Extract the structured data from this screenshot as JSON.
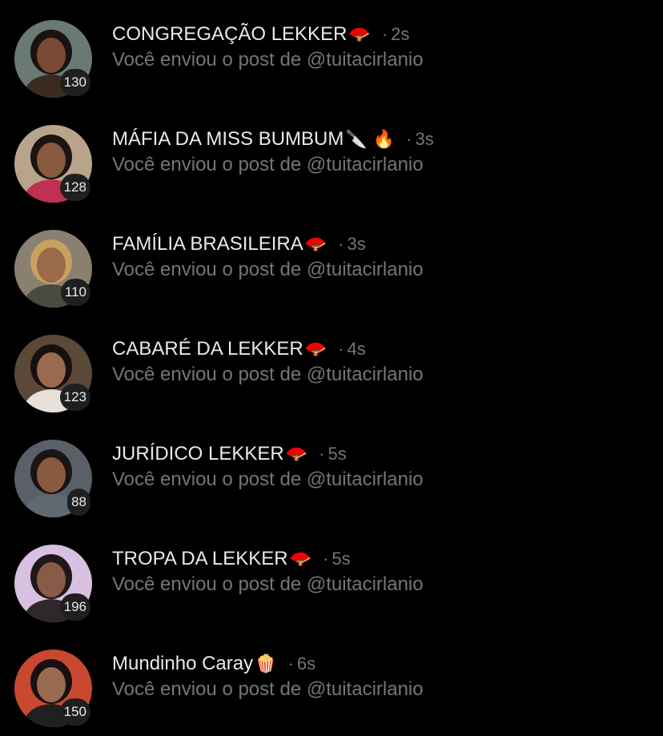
{
  "conversations": [
    {
      "name": "CONGREGAÇÃO LEKKER",
      "emoji": "🪭",
      "separator": "·",
      "time": "2s",
      "preview": "Você enviou o post de @tuitacirlanio",
      "member_count": "130",
      "avatar_colors": {
        "bg": "#6a7a72",
        "skin": "#7a4a35",
        "hair": "#1a1210",
        "cloth": "#3a2a20"
      }
    },
    {
      "name": "MÁFIA DA MISS BUMBUM",
      "emoji": "🔪 🔥",
      "separator": "·",
      "time": "3s",
      "preview": "Você enviou o post de @tuitacirlanio",
      "member_count": "128",
      "avatar_colors": {
        "bg": "#b8a48a",
        "skin": "#8a5a40",
        "hair": "#1c1410",
        "cloth": "#c03050"
      }
    },
    {
      "name": "FAMÍLIA BRASILEIRA",
      "emoji": "🪭",
      "separator": "·",
      "time": "3s",
      "preview": "Você enviou o post de @tuitacirlanio",
      "member_count": "110",
      "avatar_colors": {
        "bg": "#8a8070",
        "skin": "#9a6a4a",
        "hair": "#c8a060",
        "cloth": "#4a4a40"
      }
    },
    {
      "name": "CABARÉ DA LEKKER ",
      "emoji": "🪭",
      "separator": "·",
      "time": "4s",
      "preview": "Você enviou o post de @tuitacirlanio",
      "member_count": "123",
      "avatar_colors": {
        "bg": "#5a4838",
        "skin": "#9a6a50",
        "hair": "#181010",
        "cloth": "#e8e0d8"
      }
    },
    {
      "name": "JURÍDICO LEKKER",
      "emoji": "🪭",
      "separator": "·",
      "time": "5s",
      "preview": "Você enviou o post de @tuitacirlanio",
      "member_count": "88",
      "avatar_colors": {
        "bg": "#5a6068",
        "skin": "#8a5a40",
        "hair": "#1a1412",
        "cloth": "#606870"
      }
    },
    {
      "name": "TROPA DA LEKKER ",
      "emoji": "🪭",
      "separator": "·",
      "time": "5s",
      "preview": "Você enviou o post de @tuitacirlanio",
      "member_count": "196",
      "avatar_colors": {
        "bg": "#d8c0e0",
        "skin": "#8a5a48",
        "hair": "#201818",
        "cloth": "#302828"
      }
    },
    {
      "name": "Mundinho Caray",
      "emoji": "🍿",
      "separator": "·",
      "time": "6s",
      "preview": "Você enviou o post de @tuitacirlanio",
      "member_count": "150",
      "avatar_colors": {
        "bg": "#c84830",
        "skin": "#9a6a50",
        "hair": "#181010",
        "cloth": "#202020"
      }
    }
  ]
}
